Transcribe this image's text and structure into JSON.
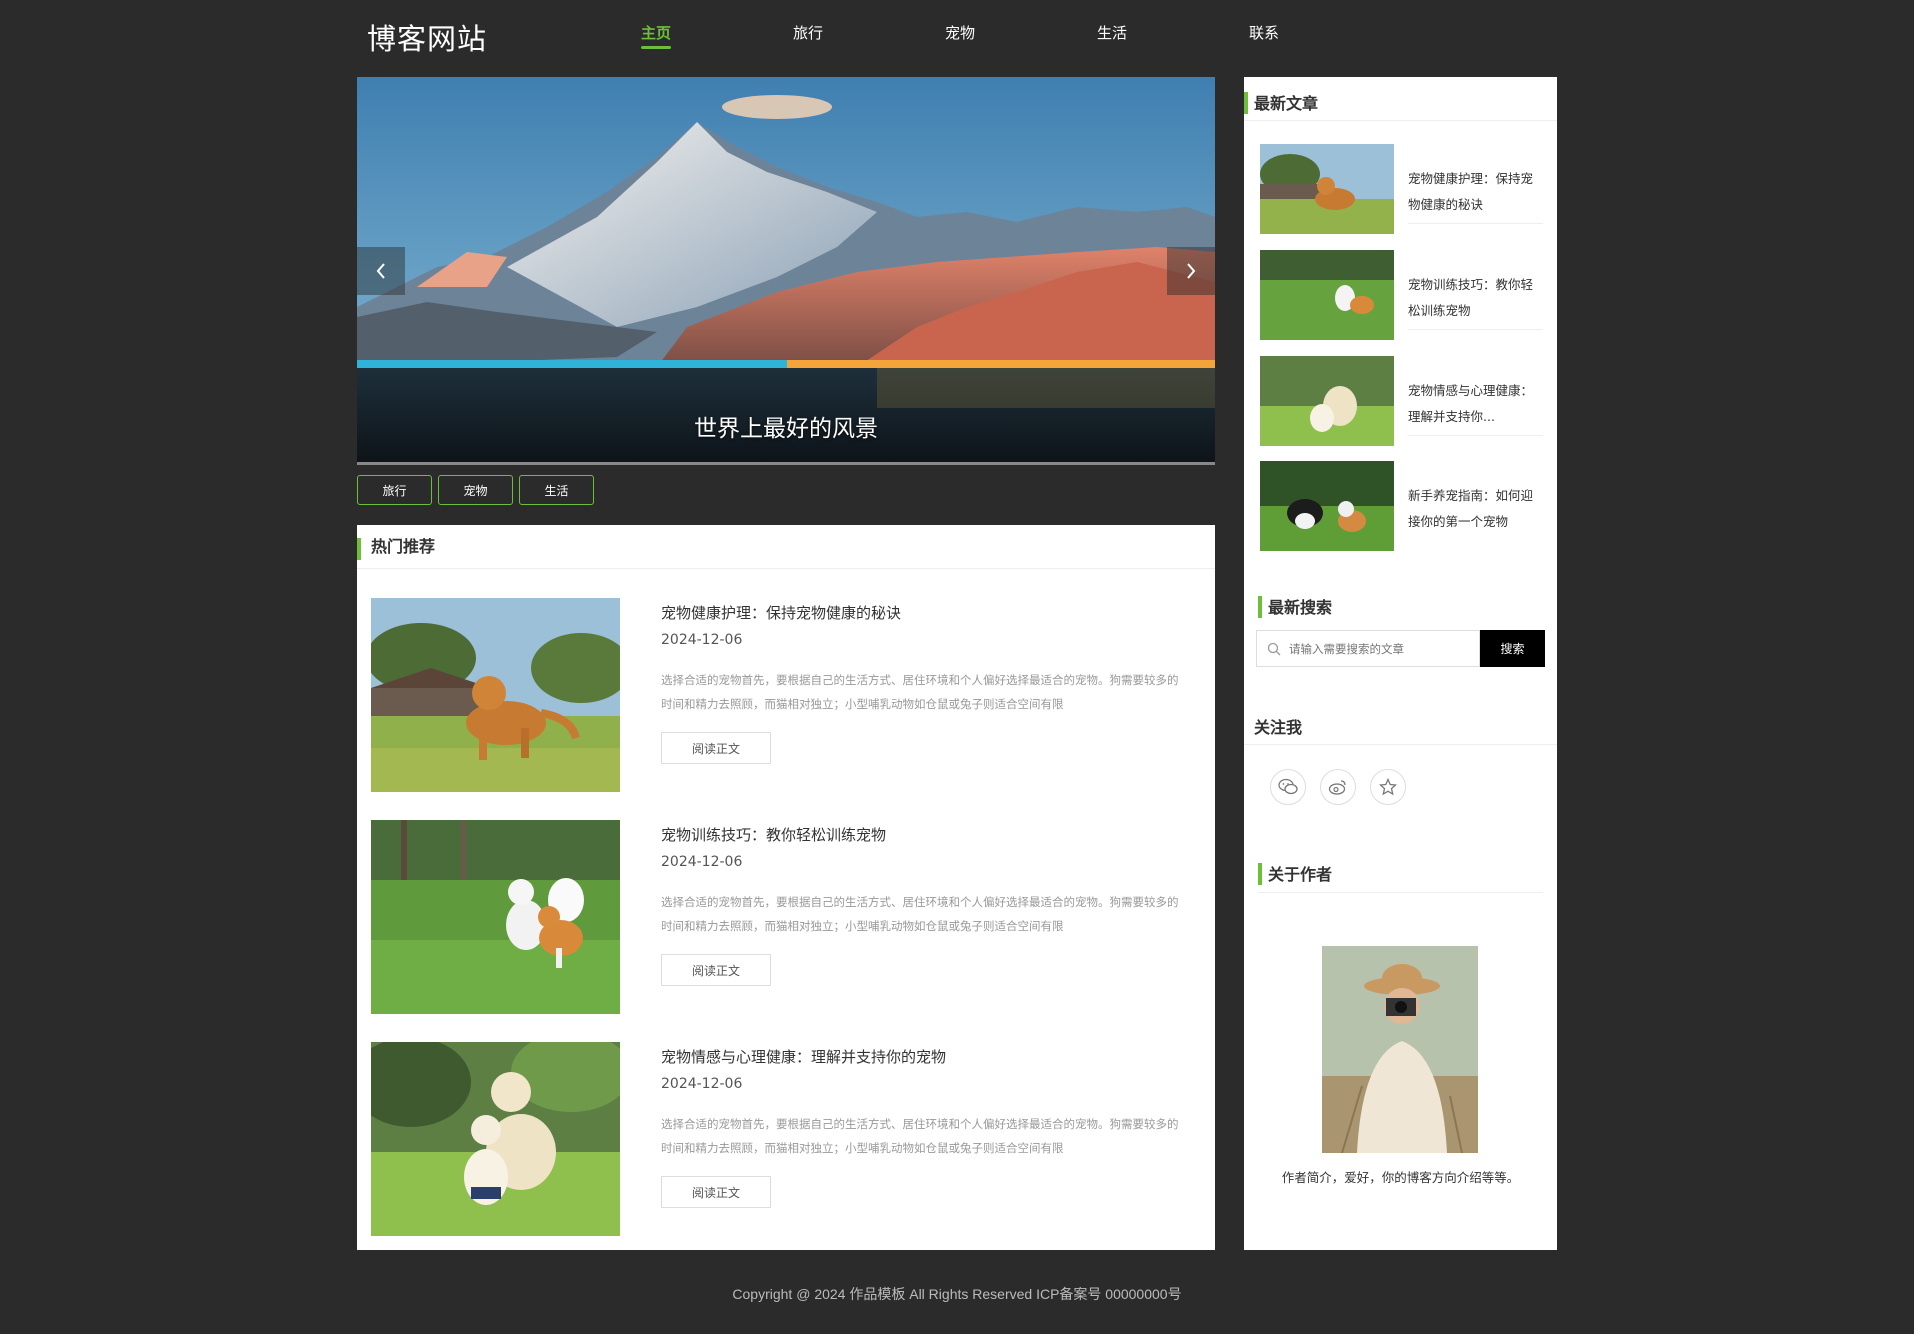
{
  "site": {
    "logo": "博客网站",
    "nav": [
      {
        "label": "主页",
        "active": true
      },
      {
        "label": "旅行",
        "active": false
      },
      {
        "label": "宠物",
        "active": false
      },
      {
        "label": "生活",
        "active": false
      },
      {
        "label": "联系",
        "active": false
      }
    ]
  },
  "banner": {
    "caption": "世界上最好的风景",
    "prev_icon": "chevron-left-icon",
    "next_icon": "chevron-right-icon"
  },
  "tags": [
    "旅行",
    "宠物",
    "生活"
  ],
  "hot": {
    "title": "热门推荐",
    "articles": [
      {
        "title": "宠物健康护理：保持宠物健康的秘诀",
        "date": "2024-12-06",
        "desc": "选择合适的宠物首先，要根据自己的生活方式、居住环境和个人偏好选择最适合的宠物。狗需要较多的时间和精力去照顾，而猫相对独立；小型哺乳动物如仓鼠或兔子则适合空间有限",
        "button": "阅读正文"
      },
      {
        "title": "宠物训练技巧：教你轻松训练宠物",
        "date": "2024-12-06",
        "desc": "选择合适的宠物首先，要根据自己的生活方式、居住环境和个人偏好选择最适合的宠物。狗需要较多的时间和精力去照顾，而猫相对独立；小型哺乳动物如仓鼠或兔子则适合空间有限",
        "button": "阅读正文"
      },
      {
        "title": "宠物情感与心理健康：理解并支持你的宠物",
        "date": "2024-12-06",
        "desc": "选择合适的宠物首先，要根据自己的生活方式、居住环境和个人偏好选择最适合的宠物。狗需要较多的时间和精力去照顾，而猫相对独立；小型哺乳动物如仓鼠或兔子则适合空间有限",
        "button": "阅读正文"
      }
    ]
  },
  "sidebar": {
    "latest_title": "最新文章",
    "latest": [
      "宠物健康护理：保持宠物健康的秘诀",
      "宠物训练技巧：教你轻松训练宠物",
      "宠物情感与心理健康：理解并支持你...",
      "新手养宠指南：如何迎接你的第一个宠物"
    ],
    "search_title": "最新搜索",
    "search_placeholder": "请输入需要搜索的文章",
    "search_button": "搜索",
    "follow_title": "关注我",
    "socials": [
      "wechat-icon",
      "weibo-icon",
      "star-icon"
    ],
    "about_title": "关于作者",
    "about_desc": "作者简介，爱好，你的博客方向介绍等等。"
  },
  "footer": "Copyright @ 2024 作品模板 All Rights Reserved  ICP备案号 00000000号",
  "colors": {
    "accent": "#6dbf3a",
    "background": "#2b2b2b"
  }
}
